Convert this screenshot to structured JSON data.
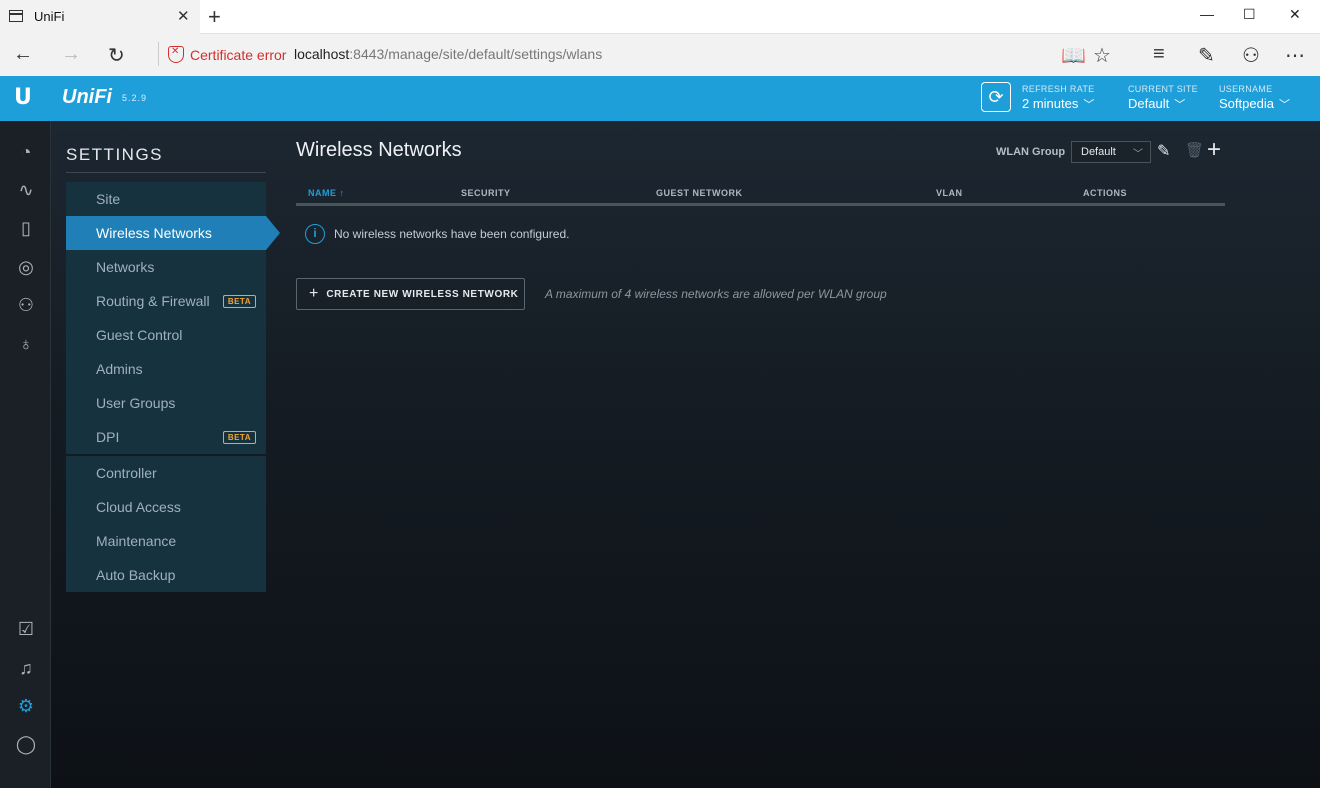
{
  "browser": {
    "tab_title": "UniFi",
    "certificate_error": "Certificate error",
    "url_host": "localhost",
    "url_rest": ":8443/manage/site/default/settings/wlans"
  },
  "header": {
    "brand": "UniFi",
    "version": "5.2.9",
    "refresh_rate_label": "REFRESH RATE",
    "refresh_rate_value": "2 minutes",
    "current_site_label": "CURRENT SITE",
    "current_site_value": "Default",
    "username_label": "USERNAME",
    "username_value": "Softpedia"
  },
  "settings": {
    "title": "SETTINGS",
    "group1": [
      {
        "label": "Site"
      },
      {
        "label": "Wireless Networks",
        "active": true
      },
      {
        "label": "Networks"
      },
      {
        "label": "Routing & Firewall",
        "badge": "BETA"
      },
      {
        "label": "Guest Control"
      },
      {
        "label": "Admins"
      },
      {
        "label": "User Groups"
      },
      {
        "label": "DPI",
        "badge": "BETA"
      }
    ],
    "group2": [
      {
        "label": "Controller"
      },
      {
        "label": "Cloud Access"
      },
      {
        "label": "Maintenance"
      },
      {
        "label": "Auto Backup"
      }
    ]
  },
  "page": {
    "title": "Wireless Networks",
    "wlan_group_label": "WLAN Group",
    "wlan_group_value": "Default",
    "columns": [
      "NAME",
      "SECURITY",
      "GUEST NETWORK",
      "VLAN",
      "ACTIONS"
    ],
    "sort_arrow": "↑",
    "empty_message": "No wireless networks have been configured.",
    "create_button": "CREATE NEW WIRELESS NETWORK",
    "limit_note": "A maximum of 4 wireless networks are allowed per WLAN group"
  },
  "colors": {
    "accent": "#1f9fd9",
    "beta": "#f0a432",
    "cert_error": "#d32f2f"
  }
}
